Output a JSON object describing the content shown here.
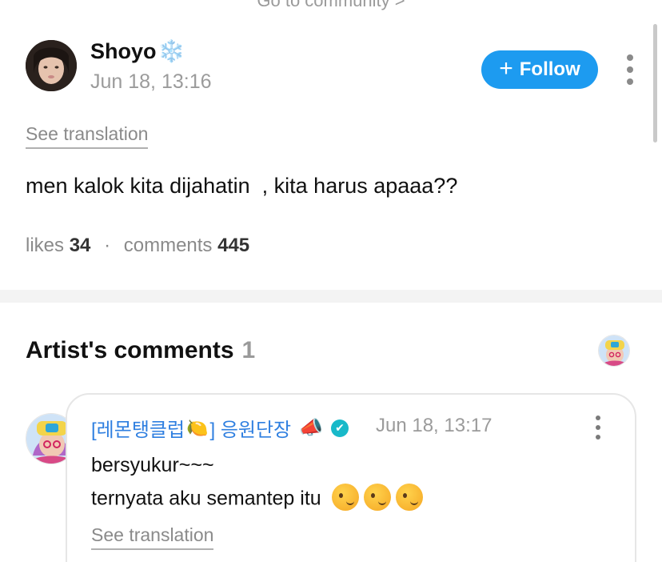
{
  "top": {
    "community_link": "Go to community >"
  },
  "post": {
    "author": "Shoyo",
    "author_badge": "❄️",
    "timestamp": "Jun 18, 13:16",
    "follow_label": "Follow",
    "see_translation": "See translation",
    "body": "men kalok kita dijahatin  , kita harus apaaa??",
    "likes_label": "likes",
    "likes_count": "34",
    "separator": "·",
    "comments_label": "comments",
    "comments_count": "445"
  },
  "artist_comments": {
    "title": "Artist's comments",
    "count": "1",
    "comment": {
      "author_prefix": "[레몬탱클럽",
      "lemon_emoji": "🍋",
      "author_suffix": "] 응원단장",
      "megaphone_emoji": "📣",
      "verified_symbol": "✔",
      "timestamp": "Jun 18, 13:17",
      "line1": "bersyukur~~~",
      "line2": "ternyata aku semantep itu",
      "see_translation": "See translation"
    }
  },
  "colors": {
    "follow_button": "#1d9bf0",
    "artist_name": "#2f7fe0",
    "verified_badge": "#18b9c9"
  },
  "icons": {
    "follow": "plus-icon",
    "more": "vertical-ellipsis-icon",
    "verified": "verified-check-icon",
    "wink": "winking-face-icon"
  }
}
